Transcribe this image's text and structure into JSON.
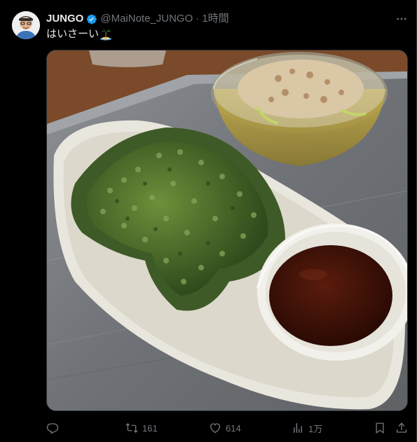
{
  "tweet": {
    "display_name": "JUNGO",
    "handle": "@MaiNote_JUNGO",
    "separator": "·",
    "time": "1時間",
    "text": "はいさーい",
    "emoji": "desert-island-emoji"
  },
  "actions": {
    "reply_count": "",
    "retweet_count": "161",
    "like_count": "614",
    "views_count": "1万"
  },
  "colors": {
    "background": "#000000",
    "text_primary": "#e7e9ea",
    "text_secondary": "#71767b",
    "verified": "#1d9bf0",
    "border": "#2f3336"
  },
  "icons": [
    "verified-badge-icon",
    "more-icon",
    "reply-icon",
    "retweet-icon",
    "like-icon",
    "views-icon",
    "bookmark-icon",
    "share-icon"
  ]
}
